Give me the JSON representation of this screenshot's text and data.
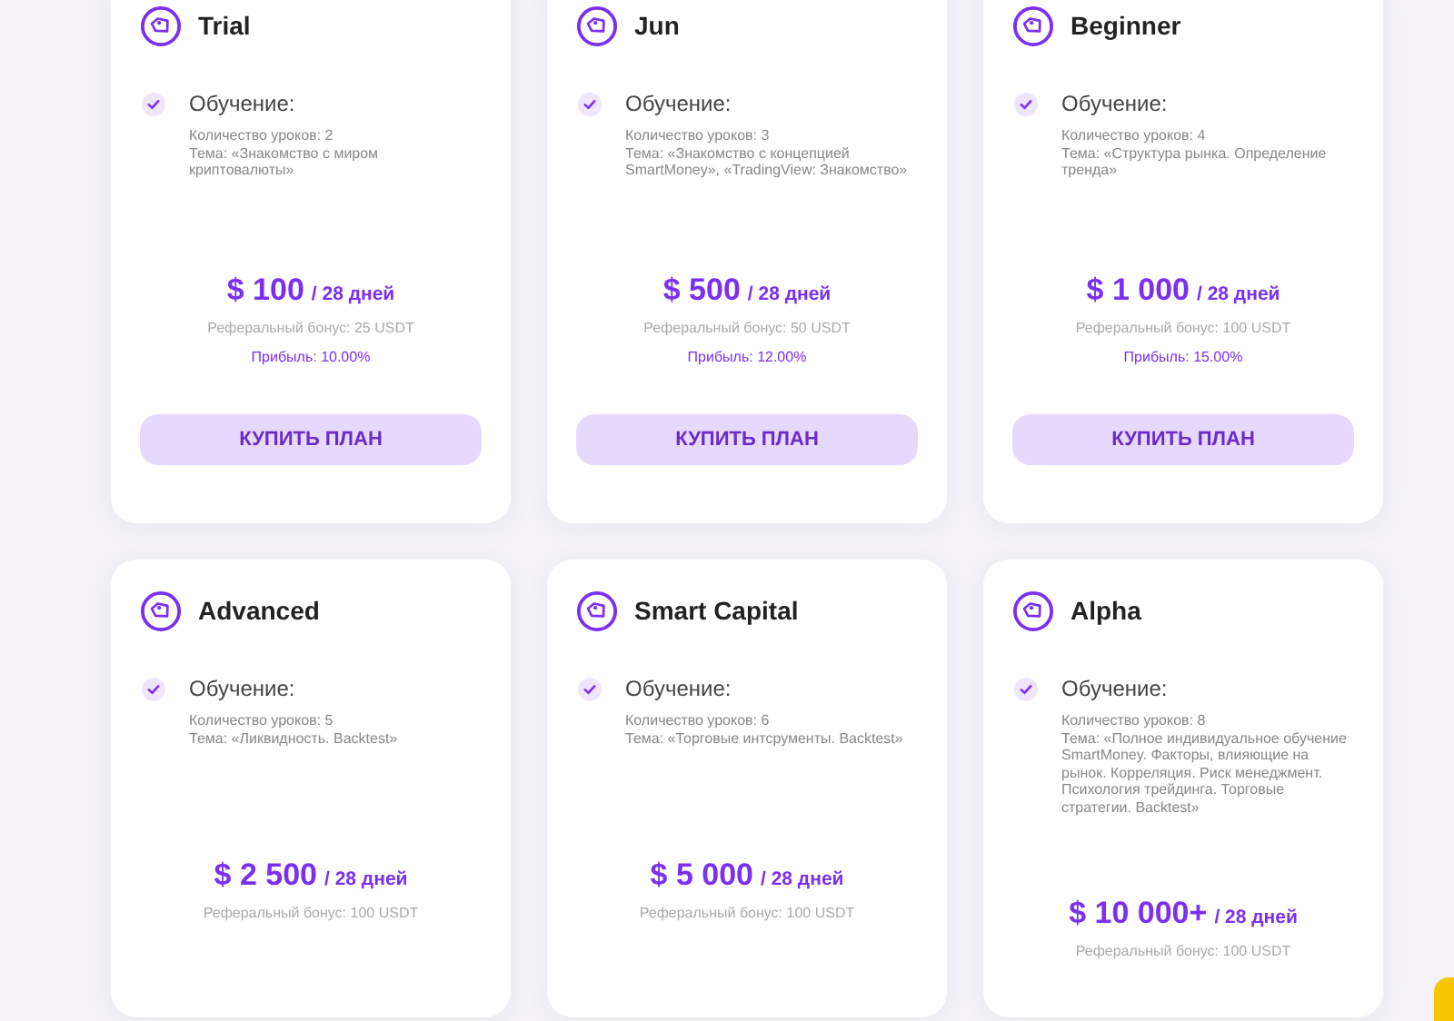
{
  "plans": [
    {
      "name": "Trial",
      "feature": "Обучение:",
      "lessons": "Количество уроков: 2",
      "topic": "Тема: «Знакомство с миром криптовалюты»",
      "price": "$ 100",
      "period": "/ 28 дней",
      "referral": "Реферальный бонус: 25 USDT",
      "profit": "Прибыль: 10.00%",
      "button": "КУПИТЬ ПЛАН"
    },
    {
      "name": "Jun",
      "feature": "Обучение:",
      "lessons": "Количество уроков: 3",
      "topic": "Тема: «Знакомство с концепцией SmartMoney», «TradingView: Знакомство»",
      "price": "$ 500",
      "period": "/ 28 дней",
      "referral": "Реферальный бонус: 50 USDT",
      "profit": "Прибыль: 12.00%",
      "button": "КУПИТЬ ПЛАН"
    },
    {
      "name": "Beginner",
      "feature": "Обучение:",
      "lessons": "Количество уроков: 4",
      "topic": "Тема: «Структура рынка. Определение тренда»",
      "price": "$ 1 000",
      "period": "/ 28 дней",
      "referral": "Реферальный бонус: 100 USDT",
      "profit": "Прибыль: 15.00%",
      "button": "КУПИТЬ ПЛАН"
    },
    {
      "name": "Advanced",
      "feature": "Обучение:",
      "lessons": "Количество уроков: 5",
      "topic": "Тема: «Ликвидность. Backtest»",
      "price": "$ 2 500",
      "period": "/ 28 дней",
      "referral": "Реферальный бонус: 100 USDT"
    },
    {
      "name": "Smart Capital",
      "feature": "Обучение:",
      "lessons": "Количество уроков: 6",
      "topic": "Тема: «Торговые интсрументы. Backtest»",
      "price": "$ 5 000",
      "period": "/ 28 дней",
      "referral": "Реферальный бонус: 100 USDT"
    },
    {
      "name": "Alpha",
      "feature": "Обучение:",
      "lessons": "Количество уроков: 8",
      "topic": "Тема: «Полное индивидуальное обучение SmartMoney. Факторы, влияющие на рынок. Корреляция. Риск менеджмент. Психология трейдинга. Торговые стратегии. Backtest»",
      "price": "$ 10 000+",
      "period": "/ 28 дней",
      "referral": "Реферальный бонус: 100 USDT"
    }
  ]
}
